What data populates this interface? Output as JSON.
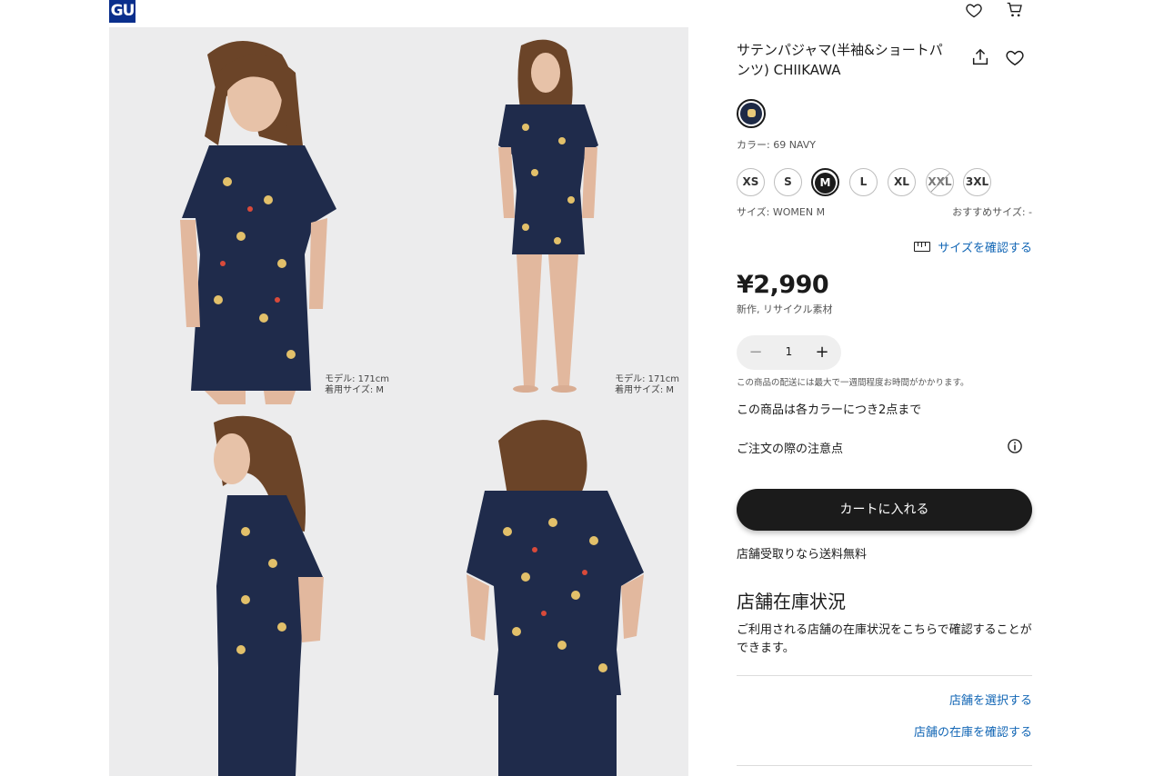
{
  "header": {
    "logo_text": "GU",
    "icons": [
      "heart-icon",
      "cart-icon"
    ]
  },
  "gallery": {
    "photos": [
      {
        "caption_model": "モデル: 171cm",
        "caption_size": "着用サイズ: M"
      },
      {
        "caption_model": "モデル: 171cm",
        "caption_size": "着用サイズ: M"
      },
      {
        "caption_model": "",
        "caption_size": ""
      },
      {
        "caption_model": "",
        "caption_size": ""
      }
    ]
  },
  "product": {
    "title": "サテンパジャマ(半袖&ショートパンツ) CHIIKAWA",
    "color_label": "カラー: 69 NAVY",
    "sizes": [
      {
        "label": "XS",
        "state": "available"
      },
      {
        "label": "S",
        "state": "available"
      },
      {
        "label": "M",
        "state": "selected"
      },
      {
        "label": "L",
        "state": "available"
      },
      {
        "label": "XL",
        "state": "available"
      },
      {
        "label": "XXL",
        "state": "sold-out"
      },
      {
        "label": "3XL",
        "state": "available"
      }
    ],
    "size_label": "サイズ: WOMEN M",
    "recommended_size": "おすすめサイズ: -",
    "size_check_link": "サイズを確認する",
    "price": "¥2,990",
    "price_note": "新作, リサイクル素材",
    "quantity": "1",
    "delivery_note": "この商品の配送には最大で一週間程度お時間がかかります。",
    "limit_note": "この商品は各カラーにつき2点まで",
    "order_notes_label": "ご注文の際の注意点",
    "add_to_cart": "カートに入れる",
    "pickup_note": "店舗受取りなら送料無料"
  },
  "store": {
    "heading": "店舗在庫状況",
    "description": "ご利用される店舗の在庫状況をこちらで確認することができます。",
    "select_store": "店舗を選択する",
    "check_stock": "店舗の在庫を確認する"
  },
  "colors": {
    "accent_link": "#1266b5",
    "primary_button": "#1b1b1b",
    "brand": "#0a2f8c",
    "navy": "#1e2a46"
  }
}
